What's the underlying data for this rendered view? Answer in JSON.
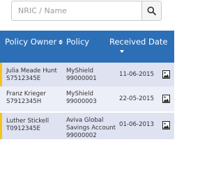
{
  "search": {
    "placeholder": "NRIC / Name",
    "value": "",
    "button_icon": "search-icon"
  },
  "table": {
    "header_color": "#2c6fb6",
    "row_flag_color": "#f3c31c",
    "columns": [
      {
        "label": "Policy Owner",
        "sort": "sortable"
      },
      {
        "label": "Policy",
        "sort": "none"
      },
      {
        "label": "Received Date",
        "sort": "descending"
      }
    ],
    "rows": [
      {
        "owner_name": "Julia Meade Hunt",
        "owner_id": "S7512345E",
        "policy_lines": [
          "MyShield",
          "99000001"
        ],
        "received_date": "11-06-2015",
        "action_icon": "image-document-icon"
      },
      {
        "owner_name": "Franz Krieger",
        "owner_id": "S7912345H",
        "policy_lines": [
          "MyShield",
          "99000003"
        ],
        "received_date": "22-05-2015",
        "action_icon": "image-document-icon"
      },
      {
        "owner_name": "Luther Stickell",
        "owner_id": "T0912345E",
        "policy_lines": [
          "Aviva Global",
          "Savings Account",
          "99000002"
        ],
        "received_date": "01-06-2013",
        "action_icon": "image-document-icon"
      }
    ]
  }
}
